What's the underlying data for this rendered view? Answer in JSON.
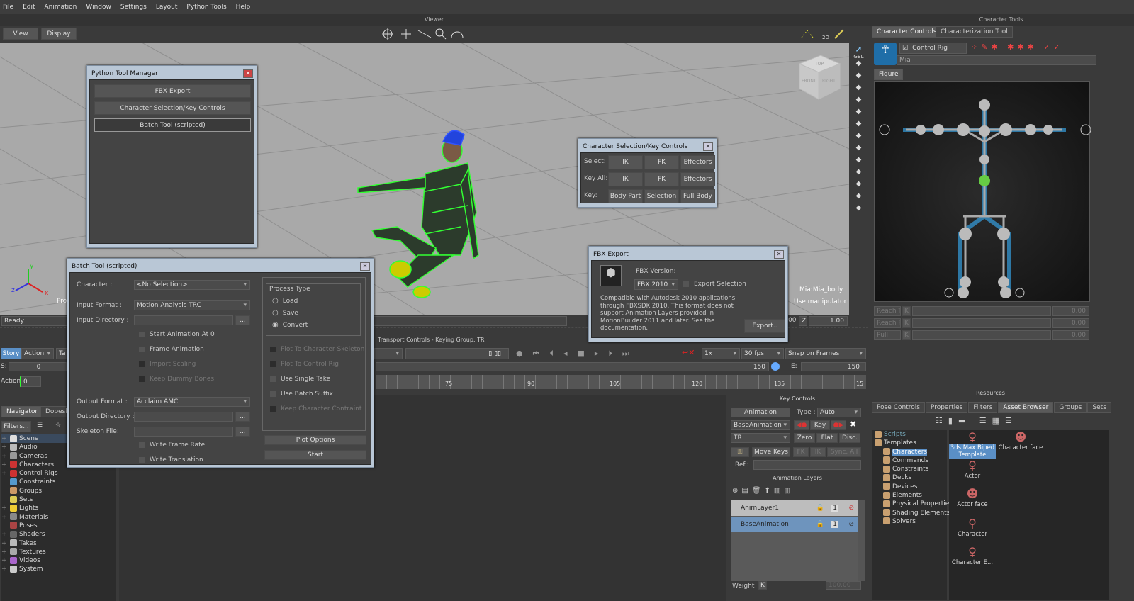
{
  "menu": [
    "File",
    "Edit",
    "Animation",
    "Window",
    "Settings",
    "Layout",
    "Python Tools",
    "Help"
  ],
  "viewer": {
    "title": "Viewer",
    "view_btn": "View",
    "display_btn": "Display",
    "cube_top": "TOP",
    "cube_front": "FRONT",
    "cube_right": "RIGHT",
    "model_label": "Mia:Mia_body",
    "hint": "Use manipulator",
    "pro_text": "Pro",
    "axis_x": "x",
    "axis_y": "y",
    "axis_z": "z",
    "gbl": "GBL",
    "twod": "2D"
  },
  "status": {
    "text": "Ready",
    "z_label": "Z",
    "z_value": "1.00",
    "prev_value": "00"
  },
  "python_tool_manager": {
    "title": "Python Tool Manager",
    "buttons": [
      "FBX Export",
      "Character Selection/Key Controls",
      "Batch Tool (scripted)"
    ]
  },
  "char_sel": {
    "title": "Character Selection/Key Controls",
    "rows": [
      {
        "label": "Select:",
        "b": [
          "IK",
          "FK",
          "Effectors"
        ]
      },
      {
        "label": "Key All:",
        "b": [
          "IK",
          "FK",
          "Effectors"
        ]
      },
      {
        "label": "Key:",
        "b": [
          "Body Part",
          "Selection",
          "Full Body"
        ]
      }
    ]
  },
  "fbx": {
    "title": "FBX Export",
    "version_label": "FBX Version:",
    "version": "FBX 2010",
    "export_selection": "Export Selection",
    "desc": "Compatible with Autodesk 2010 applications through FBXSDK 2010. This format does not support Animation Layers provided in MotionBuilder 2011 and later. See the documentation.",
    "export_btn": "Export.."
  },
  "batch": {
    "title": "Batch Tool (scripted)",
    "character_label": "Character :",
    "character": "<No Selection>",
    "input_format_label": "Input Format :",
    "input_format": "Motion Analysis TRC",
    "input_dir_label": "Input Directory :",
    "browse": "...",
    "checks_left": [
      {
        "label": "Start Animation At 0",
        "enabled": true
      },
      {
        "label": "Frame Animation",
        "enabled": true
      },
      {
        "label": "Import Scaling",
        "enabled": false
      },
      {
        "label": "Keep Dummy Bones",
        "enabled": false
      }
    ],
    "output_format_label": "Output Format :",
    "output_format": "Acclaim AMC",
    "output_dir_label": "Output Directory :",
    "skeleton_label": "Skeleton File:",
    "checks_bottom": [
      "Write Frame Rate",
      "Write Translation"
    ],
    "process_type": "Process Type",
    "radios": [
      {
        "label": "Load",
        "checked": false
      },
      {
        "label": "Save",
        "checked": false
      },
      {
        "label": "Convert",
        "checked": true
      }
    ],
    "checks_right": [
      {
        "label": "Plot To Character Skeleton",
        "enabled": false
      },
      {
        "label": "Plot To Control Rig",
        "enabled": false
      },
      {
        "label": "Use Single Take",
        "enabled": true
      },
      {
        "label": "Use Batch Suffix",
        "enabled": true
      },
      {
        "label": "Keep Character Contraint",
        "enabled": false
      }
    ],
    "plot_options": "Plot Options",
    "start": "Start"
  },
  "transport": {
    "header": "Transport Controls  -  Keying Group: TR",
    "story": "Story",
    "action": "Action",
    "take": "Ta",
    "s_label": "S:",
    "s_value": "0",
    "action_label": "Action",
    "action_clip": "0",
    "speed": "1x",
    "fps": "30 fps",
    "snap": "Snap on Frames",
    "end_frame": "150",
    "e_label": "E:",
    "e_value": "150",
    "ruler": [
      "75",
      "90",
      "105",
      "120",
      "135",
      "15"
    ]
  },
  "navigator": {
    "tabs": [
      "Navigator",
      "Dopeshe"
    ],
    "filters": "Filters...",
    "items": [
      {
        "label": "Scene",
        "exp": true,
        "c": "#ddd"
      },
      {
        "label": "Audio",
        "exp": true,
        "c": "#bbb"
      },
      {
        "label": "Cameras",
        "exp": true,
        "c": "#999"
      },
      {
        "label": "Characters",
        "exp": true,
        "c": "#c33"
      },
      {
        "label": "Control Rigs",
        "exp": true,
        "c": "#c33"
      },
      {
        "label": "Constraints",
        "exp": false,
        "c": "#59c"
      },
      {
        "label": "Groups",
        "exp": false,
        "c": "#c96"
      },
      {
        "label": "Sets",
        "exp": false,
        "c": "#dc5"
      },
      {
        "label": "Lights",
        "exp": true,
        "c": "#ec3"
      },
      {
        "label": "Materials",
        "exp": true,
        "c": "#888"
      },
      {
        "label": "Poses",
        "exp": false,
        "c": "#a44"
      },
      {
        "label": "Shaders",
        "exp": true,
        "c": "#666"
      },
      {
        "label": "Takes",
        "exp": true,
        "c": "#bbb"
      },
      {
        "label": "Textures",
        "exp": true,
        "c": "#aaa"
      },
      {
        "label": "Videos",
        "exp": true,
        "c": "#a6c"
      },
      {
        "label": "System",
        "exp": true,
        "c": "#ccc"
      }
    ]
  },
  "key_controls": {
    "title": "Key Controls",
    "animation": "Animation",
    "type_label": "Type :",
    "type": "Auto",
    "layer": "BaseAnimation",
    "key": "Key",
    "group": "TR",
    "zero": "Zero",
    "flat": "Flat",
    "disc": "Disc.",
    "move_keys": "Move Keys",
    "fk": "FK",
    "ik": "IK",
    "sync": "Sync. All",
    "ref_label": "Ref.:",
    "anim_layers_title": "Animation Layers",
    "layers": [
      {
        "name": "AnimLayer1",
        "selected": false
      },
      {
        "name": "BaseAnimation",
        "selected": true
      }
    ],
    "weight_label": "Weight",
    "weight_key": "K",
    "weight_value": "100.00"
  },
  "character_tools": {
    "title": "Character Tools",
    "tabs": [
      "Character Controls",
      "Characterization Tool"
    ],
    "control_rig": "Control Rig",
    "character": "Mia",
    "figure_tab": "Figure",
    "sliders": [
      {
        "label": "Reach T",
        "value": "0.00"
      },
      {
        "label": "Reach R",
        "value": "0.00"
      },
      {
        "label": "Pull",
        "value": "0.00"
      }
    ],
    "key_btn": "K"
  },
  "resources": {
    "title": "Resources",
    "tabs": [
      "Pose Controls",
      "Properties",
      "Filters",
      "Asset Browser",
      "Groups",
      "Sets"
    ],
    "active_tab": "Asset Browser",
    "tree": [
      {
        "label": "Scripts",
        "indent": 0,
        "sel": false,
        "exp": false
      },
      {
        "label": "Templates",
        "indent": 0,
        "sel": false,
        "exp": false
      },
      {
        "label": "Characters",
        "indent": 1,
        "sel": true,
        "exp": false
      },
      {
        "label": "Commands",
        "indent": 1,
        "sel": false,
        "exp": false
      },
      {
        "label": "Constraints",
        "indent": 1,
        "sel": false,
        "exp": false
      },
      {
        "label": "Decks",
        "indent": 1,
        "sel": false,
        "exp": false
      },
      {
        "label": "Devices",
        "indent": 1,
        "sel": false,
        "exp": false
      },
      {
        "label": "Elements",
        "indent": 1,
        "sel": false,
        "exp": true
      },
      {
        "label": "Physical Properties",
        "indent": 1,
        "sel": false,
        "exp": true
      },
      {
        "label": "Shading Elements",
        "indent": 1,
        "sel": false,
        "exp": true
      },
      {
        "label": "Solvers",
        "indent": 1,
        "sel": false,
        "exp": false
      }
    ],
    "assets": [
      {
        "label": "3ds Max Biped Template",
        "sel": true
      },
      {
        "label": "Character face",
        "sel": false
      },
      {
        "label": "Actor",
        "sel": false
      },
      {
        "label": "Actor face",
        "sel": false
      },
      {
        "label": "Character",
        "sel": false
      },
      {
        "label": "Character E...",
        "sel": false
      }
    ]
  },
  "colors": {
    "accent": "#5a8fc6",
    "wire": "#33ff33",
    "viewport": "#a9a9a9"
  }
}
